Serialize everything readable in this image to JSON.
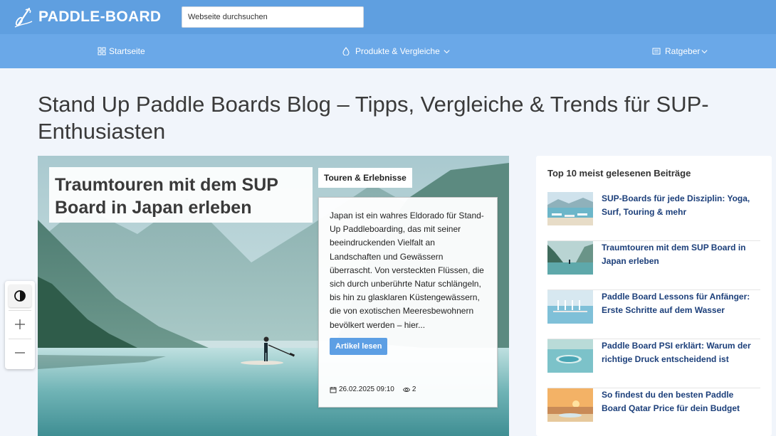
{
  "header": {
    "logo_text": "PADDLE-BOARD",
    "search_placeholder": "Webseite durchsuchen"
  },
  "nav": {
    "items": [
      {
        "label": "Startseite",
        "icon": "grid-icon"
      },
      {
        "label": "Produkte & Vergleiche",
        "icon": "drop-icon",
        "dropdown": true
      },
      {
        "label": "Ratgeber",
        "icon": "list-icon",
        "dropdown": true
      }
    ]
  },
  "page": {
    "title": "Stand Up Paddle Boards Blog – Tipps, Vergleiche & Trends für SUP-Enthusiasten"
  },
  "hero": {
    "title": "Traumtouren mit dem SUP Board in Japan erleben",
    "category": "Touren & Erlebnisse",
    "excerpt": "Japan ist ein wahres Eldorado für Stand-Up Paddleboarding, das mit seiner beeindruckenden Vielfalt an Landschaften und Gewässern überrascht. Von versteckten Flüssen, die sich durch unberührte Natur schlängeln, bis hin zu glasklaren Küstengewässern, die von exotischen Meeresbewohnern bevölkert werden – hier...",
    "button_label": "Artikel lesen",
    "date": "26.02.2025 09:10",
    "views": "2"
  },
  "sidebar": {
    "title": "Top 10 meist gelesenen Beiträge",
    "items": [
      {
        "title": "SUP-Boards für jede Disziplin: Yoga, Surf, Touring & mehr"
      },
      {
        "title": "Traumtouren mit dem SUP Board in Japan erleben"
      },
      {
        "title": "Paddle Board Lessons für Anfänger: Erste Schritte auf dem Wasser"
      },
      {
        "title": "Paddle Board PSI erklärt: Warum der richtige Druck entscheidend ist"
      },
      {
        "title": "So findest du den besten Paddle Board Qatar Price für dein Budget"
      }
    ]
  },
  "colors": {
    "topbar": "#5f9fe0",
    "navbar": "#6aa8e8",
    "link": "#1c3f7a",
    "button": "#5d9fe4"
  }
}
